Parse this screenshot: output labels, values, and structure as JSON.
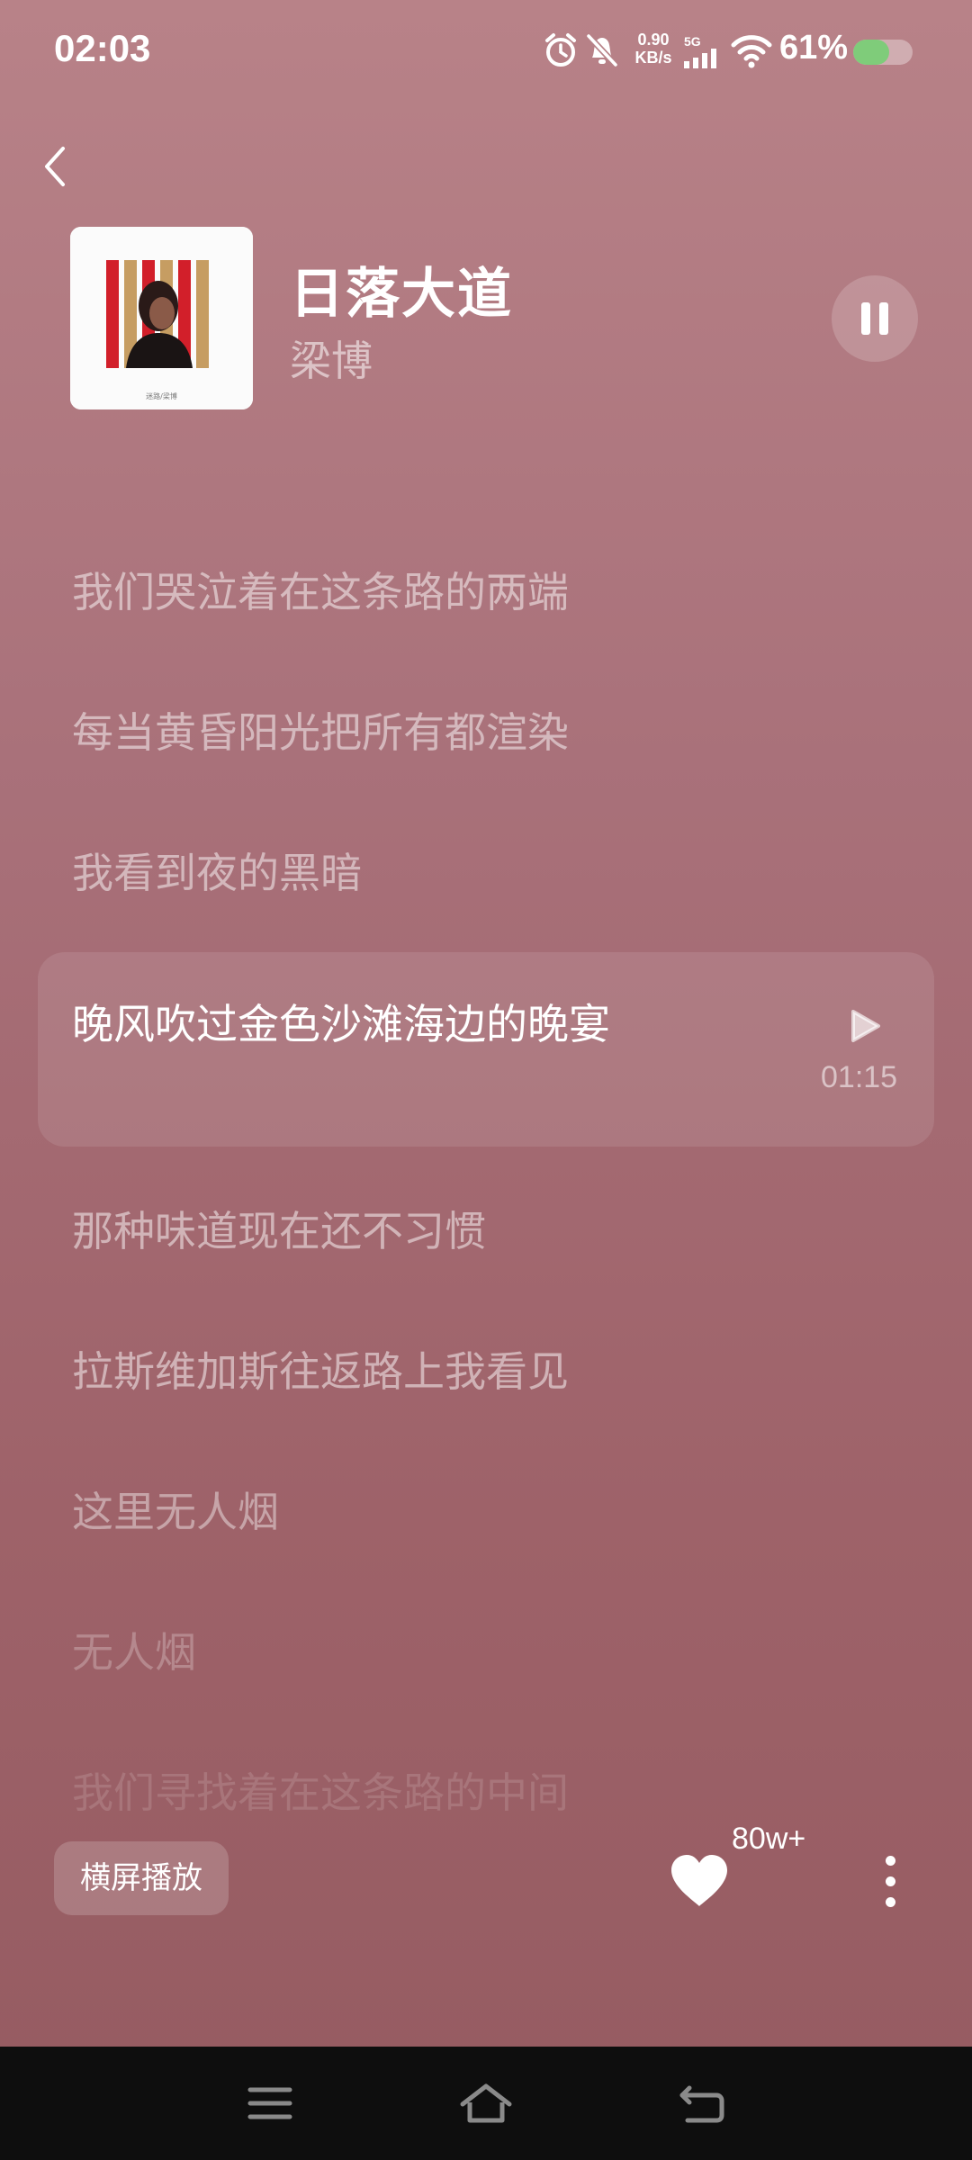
{
  "status_bar": {
    "time": "02:03",
    "net_speed_value": "0.90",
    "net_speed_unit": "KB/s",
    "network_type": "5G",
    "battery_percent": "61%",
    "battery_level": 0.61,
    "icons": [
      "alarm-icon",
      "bell-muted-icon",
      "signal-icon",
      "wifi-icon",
      "battery-icon"
    ]
  },
  "header": {
    "song_title": "日落大道",
    "artist": "梁博",
    "album_caption": "迷路/梁博"
  },
  "lyrics": {
    "lines": [
      "我们哭泣着在这条路的两端",
      "每当黄昏阳光把所有都渲染",
      "我看到夜的黑暗",
      "那种味道现在还不习惯",
      "拉斯维加斯往返路上我看见",
      "这里无人烟",
      "无人烟",
      "我们寻找着在这条路的中间"
    ],
    "active_line": "晚风吹过金色沙滩海边的晚宴",
    "active_timestamp": "01:15"
  },
  "controls": {
    "landscape_label": "横屏播放",
    "like_count": "80w+"
  },
  "colors": {
    "background_top": "#b88288",
    "background_bottom": "#955b61",
    "battery_green": "#7fcc7a",
    "album_red": "#d21f2a",
    "album_tan": "#c69d62"
  }
}
